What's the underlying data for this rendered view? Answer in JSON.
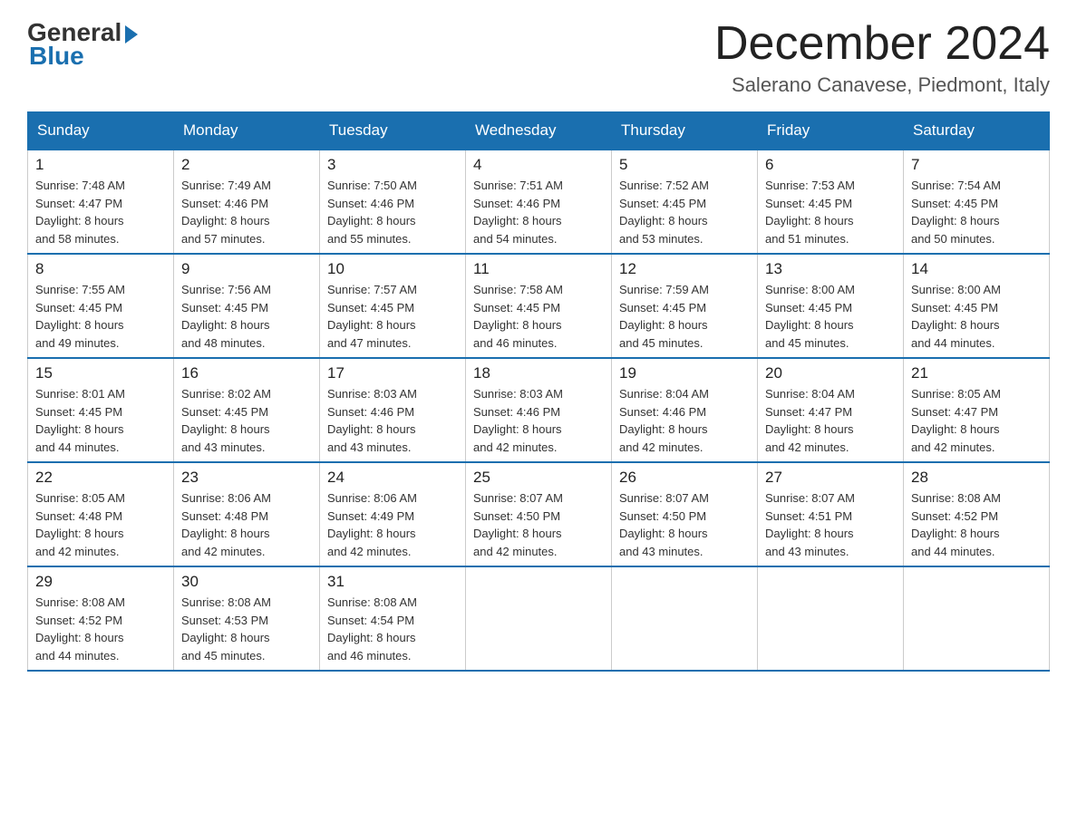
{
  "header": {
    "logo_general": "General",
    "logo_blue": "Blue",
    "month_title": "December 2024",
    "location": "Salerano Canavese, Piedmont, Italy"
  },
  "weekdays": [
    "Sunday",
    "Monday",
    "Tuesday",
    "Wednesday",
    "Thursday",
    "Friday",
    "Saturday"
  ],
  "weeks": [
    [
      {
        "day": "1",
        "sunrise": "7:48 AM",
        "sunset": "4:47 PM",
        "daylight": "8 hours and 58 minutes."
      },
      {
        "day": "2",
        "sunrise": "7:49 AM",
        "sunset": "4:46 PM",
        "daylight": "8 hours and 57 minutes."
      },
      {
        "day": "3",
        "sunrise": "7:50 AM",
        "sunset": "4:46 PM",
        "daylight": "8 hours and 55 minutes."
      },
      {
        "day": "4",
        "sunrise": "7:51 AM",
        "sunset": "4:46 PM",
        "daylight": "8 hours and 54 minutes."
      },
      {
        "day": "5",
        "sunrise": "7:52 AM",
        "sunset": "4:45 PM",
        "daylight": "8 hours and 53 minutes."
      },
      {
        "day": "6",
        "sunrise": "7:53 AM",
        "sunset": "4:45 PM",
        "daylight": "8 hours and 51 minutes."
      },
      {
        "day": "7",
        "sunrise": "7:54 AM",
        "sunset": "4:45 PM",
        "daylight": "8 hours and 50 minutes."
      }
    ],
    [
      {
        "day": "8",
        "sunrise": "7:55 AM",
        "sunset": "4:45 PM",
        "daylight": "8 hours and 49 minutes."
      },
      {
        "day": "9",
        "sunrise": "7:56 AM",
        "sunset": "4:45 PM",
        "daylight": "8 hours and 48 minutes."
      },
      {
        "day": "10",
        "sunrise": "7:57 AM",
        "sunset": "4:45 PM",
        "daylight": "8 hours and 47 minutes."
      },
      {
        "day": "11",
        "sunrise": "7:58 AM",
        "sunset": "4:45 PM",
        "daylight": "8 hours and 46 minutes."
      },
      {
        "day": "12",
        "sunrise": "7:59 AM",
        "sunset": "4:45 PM",
        "daylight": "8 hours and 45 minutes."
      },
      {
        "day": "13",
        "sunrise": "8:00 AM",
        "sunset": "4:45 PM",
        "daylight": "8 hours and 45 minutes."
      },
      {
        "day": "14",
        "sunrise": "8:00 AM",
        "sunset": "4:45 PM",
        "daylight": "8 hours and 44 minutes."
      }
    ],
    [
      {
        "day": "15",
        "sunrise": "8:01 AM",
        "sunset": "4:45 PM",
        "daylight": "8 hours and 44 minutes."
      },
      {
        "day": "16",
        "sunrise": "8:02 AM",
        "sunset": "4:45 PM",
        "daylight": "8 hours and 43 minutes."
      },
      {
        "day": "17",
        "sunrise": "8:03 AM",
        "sunset": "4:46 PM",
        "daylight": "8 hours and 43 minutes."
      },
      {
        "day": "18",
        "sunrise": "8:03 AM",
        "sunset": "4:46 PM",
        "daylight": "8 hours and 42 minutes."
      },
      {
        "day": "19",
        "sunrise": "8:04 AM",
        "sunset": "4:46 PM",
        "daylight": "8 hours and 42 minutes."
      },
      {
        "day": "20",
        "sunrise": "8:04 AM",
        "sunset": "4:47 PM",
        "daylight": "8 hours and 42 minutes."
      },
      {
        "day": "21",
        "sunrise": "8:05 AM",
        "sunset": "4:47 PM",
        "daylight": "8 hours and 42 minutes."
      }
    ],
    [
      {
        "day": "22",
        "sunrise": "8:05 AM",
        "sunset": "4:48 PM",
        "daylight": "8 hours and 42 minutes."
      },
      {
        "day": "23",
        "sunrise": "8:06 AM",
        "sunset": "4:48 PM",
        "daylight": "8 hours and 42 minutes."
      },
      {
        "day": "24",
        "sunrise": "8:06 AM",
        "sunset": "4:49 PM",
        "daylight": "8 hours and 42 minutes."
      },
      {
        "day": "25",
        "sunrise": "8:07 AM",
        "sunset": "4:50 PM",
        "daylight": "8 hours and 42 minutes."
      },
      {
        "day": "26",
        "sunrise": "8:07 AM",
        "sunset": "4:50 PM",
        "daylight": "8 hours and 43 minutes."
      },
      {
        "day": "27",
        "sunrise": "8:07 AM",
        "sunset": "4:51 PM",
        "daylight": "8 hours and 43 minutes."
      },
      {
        "day": "28",
        "sunrise": "8:08 AM",
        "sunset": "4:52 PM",
        "daylight": "8 hours and 44 minutes."
      }
    ],
    [
      {
        "day": "29",
        "sunrise": "8:08 AM",
        "sunset": "4:52 PM",
        "daylight": "8 hours and 44 minutes."
      },
      {
        "day": "30",
        "sunrise": "8:08 AM",
        "sunset": "4:53 PM",
        "daylight": "8 hours and 45 minutes."
      },
      {
        "day": "31",
        "sunrise": "8:08 AM",
        "sunset": "4:54 PM",
        "daylight": "8 hours and 46 minutes."
      },
      null,
      null,
      null,
      null
    ]
  ],
  "labels": {
    "sunrise": "Sunrise:",
    "sunset": "Sunset:",
    "daylight": "Daylight:"
  }
}
